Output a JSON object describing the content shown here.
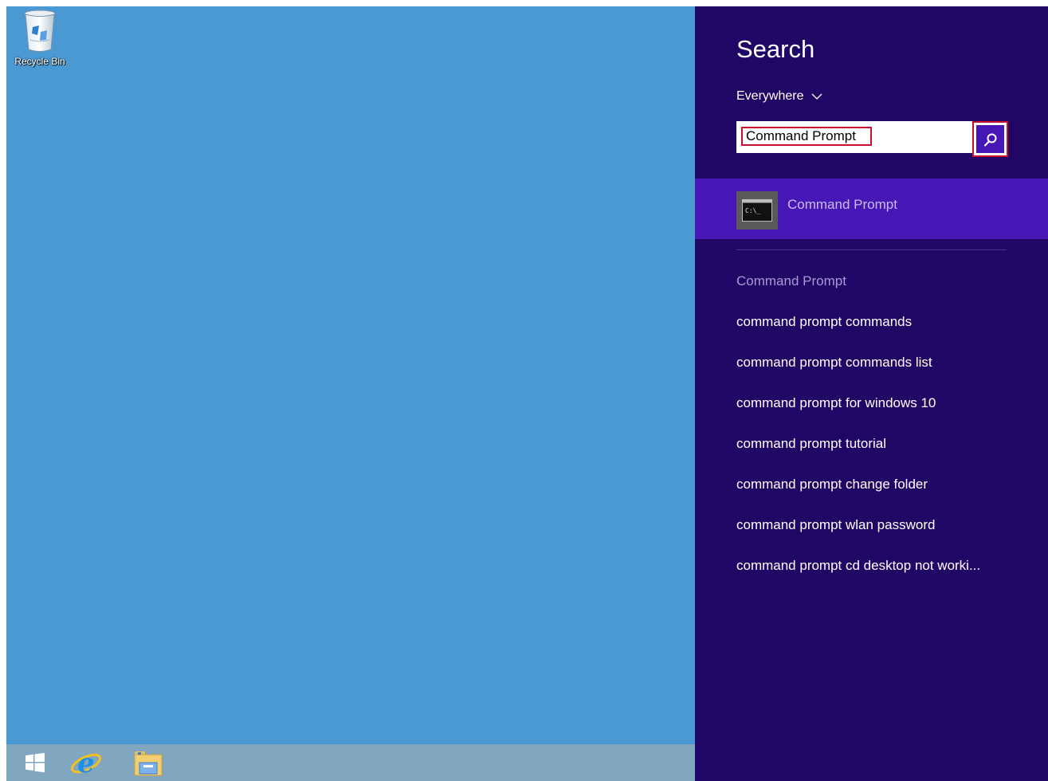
{
  "desktop": {
    "background_color": "#4b99d2",
    "icons": [
      {
        "label": "Recycle Bin",
        "icon": "recycle-bin-icon"
      }
    ]
  },
  "taskbar": {
    "buttons": [
      {
        "name": "start-button",
        "icon": "windows-logo-icon"
      },
      {
        "name": "internet-explorer-button",
        "icon": "internet-explorer-icon"
      },
      {
        "name": "file-explorer-button",
        "icon": "file-explorer-icon"
      }
    ]
  },
  "search_charm": {
    "title": "Search",
    "scope": {
      "label": "Everywhere",
      "icon": "chevron-down-icon"
    },
    "search_box": {
      "value": "Command Prompt",
      "button_icon": "search-icon"
    },
    "top_result": {
      "label": "Command Prompt",
      "icon": "command-prompt-icon",
      "icon_text": "C:\\_"
    },
    "suggestions_header": "Command Prompt",
    "suggestions": [
      "command prompt commands",
      "command prompt commands list",
      "command prompt for windows 10",
      "command prompt tutorial",
      "command prompt change folder",
      "command prompt wlan password",
      "command prompt cd desktop not worki..."
    ]
  },
  "colors": {
    "charm_background": "#200665",
    "selected_background": "#4617b4",
    "highlight_border": "#c8102e",
    "taskbar": "#80a6c0"
  }
}
